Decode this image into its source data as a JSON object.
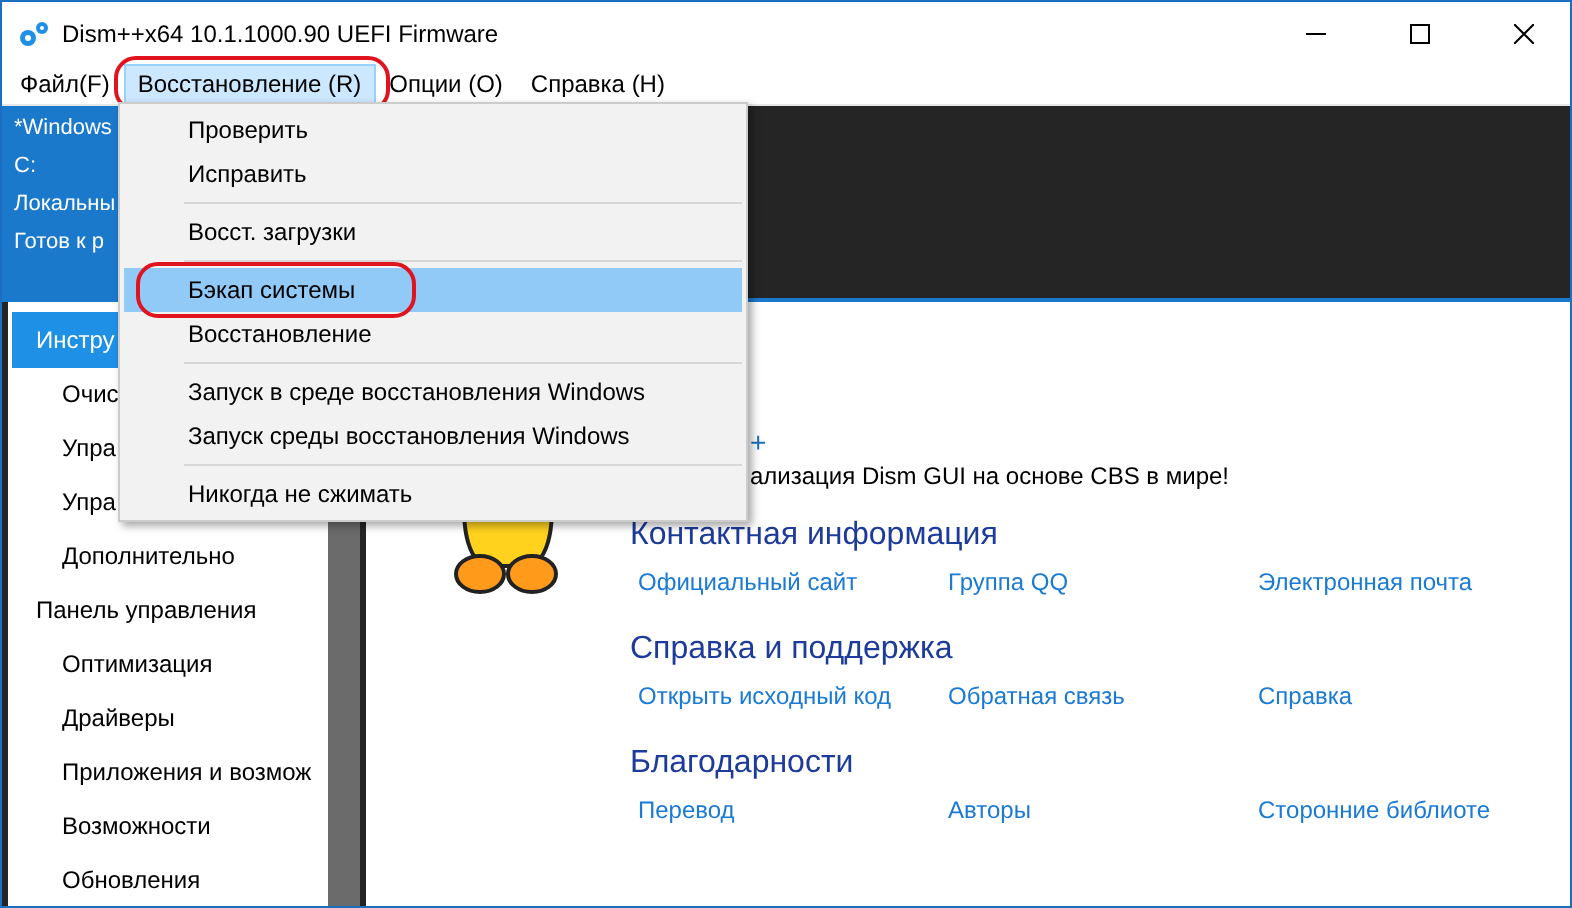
{
  "window": {
    "title": "Dism++x64 10.1.1000.90 UEFI Firmware"
  },
  "menu_bar": [
    {
      "label": "Файл(F)",
      "selected": false,
      "circled": false
    },
    {
      "label": "Восстановление (R)",
      "selected": true,
      "circled": true
    },
    {
      "label": "Опции (O)",
      "selected": false,
      "circled": false
    },
    {
      "label": "Справка (H)",
      "selected": false,
      "circled": false
    }
  ],
  "dropdown": [
    {
      "kind": "item",
      "label": "Проверить",
      "selected": false,
      "circled": false
    },
    {
      "kind": "item",
      "label": "Исправить",
      "selected": false,
      "circled": false
    },
    {
      "kind": "separator"
    },
    {
      "kind": "item",
      "label": "Восст. загрузки",
      "selected": false,
      "circled": false
    },
    {
      "kind": "separator"
    },
    {
      "kind": "item",
      "label": "Бэкап системы",
      "selected": true,
      "circled": true
    },
    {
      "kind": "item",
      "label": "Восстановление",
      "selected": false,
      "circled": false
    },
    {
      "kind": "separator"
    },
    {
      "kind": "item",
      "label": "Запуск в среде восстановления Windows",
      "selected": false,
      "circled": false
    },
    {
      "kind": "item",
      "label": "Запуск среды восстановления Windows",
      "selected": false,
      "circled": false
    },
    {
      "kind": "separator"
    },
    {
      "kind": "item",
      "label": "Никогда не сжимать",
      "selected": false,
      "circled": false
    }
  ],
  "session_info": [
    "*Windows",
    "C:",
    "Локальны",
    "Готов к р"
  ],
  "sidebar": [
    {
      "kind": "group",
      "label": "Инстру",
      "selected": true
    },
    {
      "kind": "item",
      "label": "Очис",
      "selected": false
    },
    {
      "kind": "item",
      "label": "Упра",
      "selected": false
    },
    {
      "kind": "item",
      "label": "Упра",
      "selected": false
    },
    {
      "kind": "item",
      "label": "Дополнительно",
      "selected": false
    },
    {
      "kind": "group",
      "label": "Панель управления",
      "selected": false
    },
    {
      "kind": "item",
      "label": "Оптимизация",
      "selected": false
    },
    {
      "kind": "item",
      "label": "Драйверы",
      "selected": false
    },
    {
      "kind": "item",
      "label": "Приложения и возмож",
      "selected": false
    },
    {
      "kind": "item",
      "label": "Возможности",
      "selected": false
    },
    {
      "kind": "item",
      "label": "Обновления",
      "selected": false
    }
  ],
  "about": {
    "title": "+",
    "tagline": "ализация Dism GUI на основе CBS в мире!",
    "sections": [
      {
        "heading": "Контактная информация",
        "links": [
          "Официальный сайт",
          "Группа QQ",
          "Электронная почта"
        ]
      },
      {
        "heading": "Справка и поддержка",
        "links": [
          "Открыть исходный код",
          "Обратная связь",
          "Справка"
        ]
      },
      {
        "heading": "Благодарности",
        "links": [
          "Перевод",
          "Авторы",
          "Сторонние библиоте"
        ]
      }
    ]
  }
}
